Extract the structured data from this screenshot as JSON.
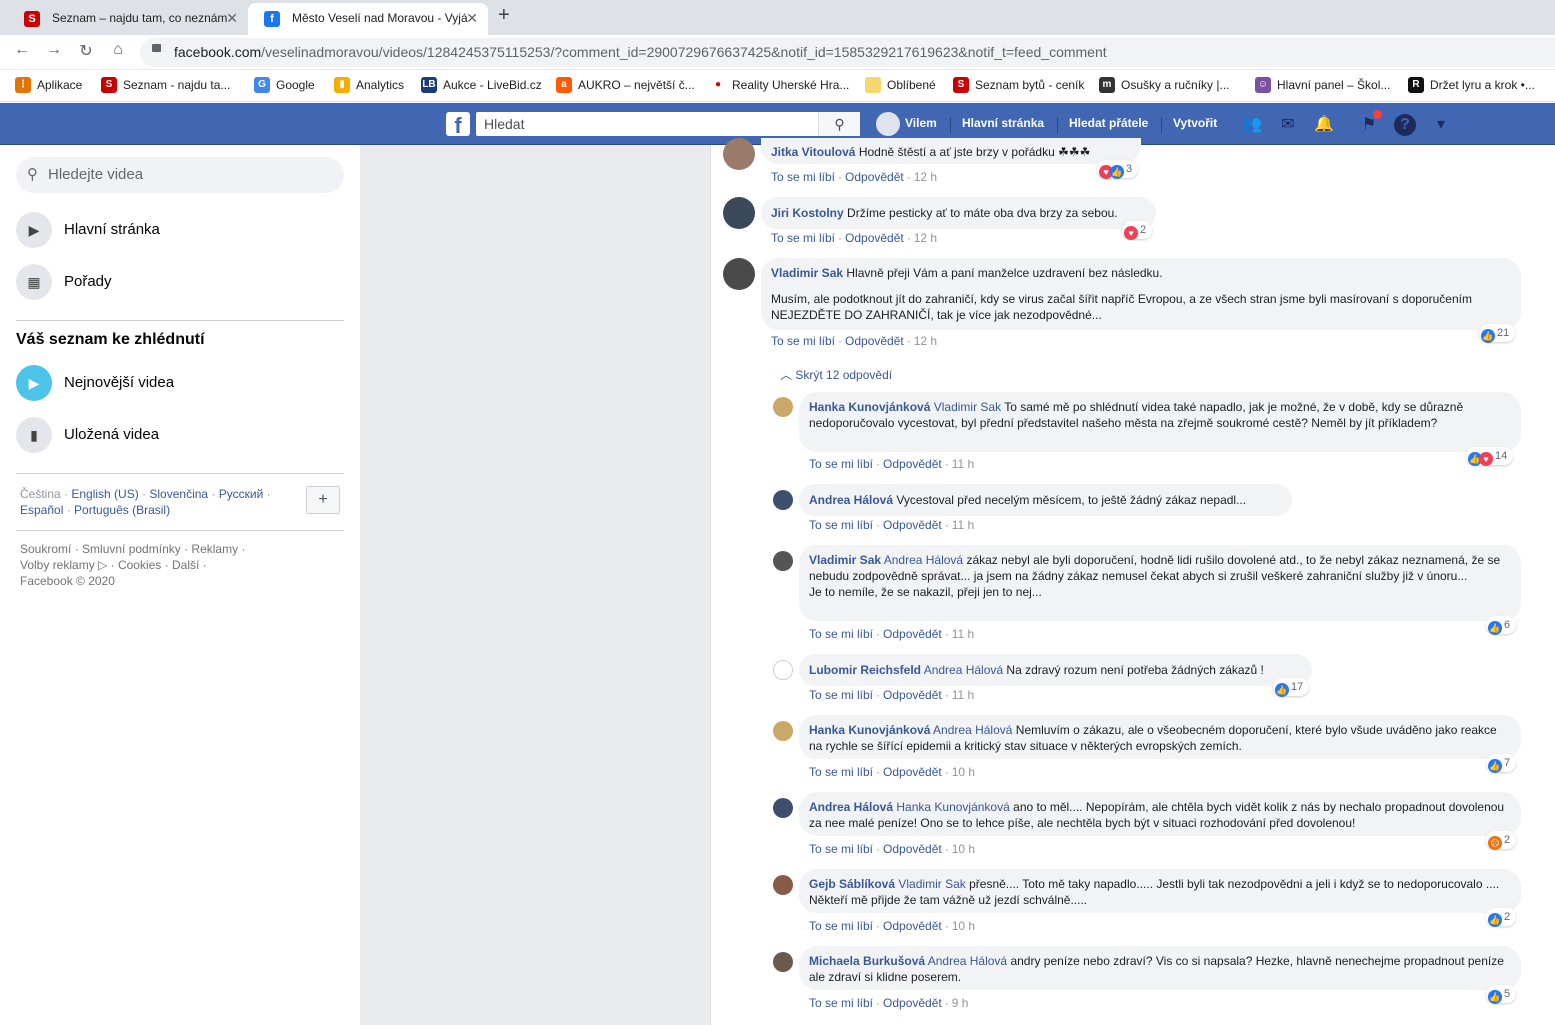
{
  "browser": {
    "tabs": [
      {
        "title": "Seznam – najdu tam, co neznám",
        "favicon": "seznam-icon",
        "color": "#cc0000"
      },
      {
        "title": "Město Veselí nad Moravou - Vyjá",
        "favicon": "facebook-icon",
        "color": "#1877f2"
      }
    ],
    "url_domain": "facebook.com",
    "url_path": "/veselinadmoravou/videos/1284245375115253/?comment_id=2900729676637425&notif_id=1585329217619623&notif_t=feed_comment",
    "bookmarks": [
      {
        "label": "Aplikace",
        "icon": "apps-grid-icon",
        "color": "#e37400"
      },
      {
        "label": "Seznam - najdu ta...",
        "icon": "seznam-icon",
        "color": "#cc0000"
      },
      {
        "label": "Google",
        "icon": "google-icon",
        "color": "#4285f4"
      },
      {
        "label": "Analytics",
        "icon": "analytics-icon",
        "color": "#f9ab00"
      },
      {
        "label": "Aukce - LiveBid.cz",
        "icon": "livebid-icon",
        "color": "#1a3a7a"
      },
      {
        "label": "AUKRO – největší č...",
        "icon": "aukro-icon",
        "color": "#ff5a00"
      },
      {
        "label": "Reality Uherské Hra...",
        "icon": "reality-icon",
        "color": "#cc0000"
      },
      {
        "label": "Oblíbené",
        "icon": "folder-icon",
        "color": "#f5d76e"
      },
      {
        "label": "Seznam bytů - ceník",
        "icon": "seznam-icon",
        "color": "#cc0000"
      },
      {
        "label": "Osušky a ručníky |...",
        "icon": "towel-shop-icon",
        "color": "#333333"
      },
      {
        "label": "Hlavní panel – Škol...",
        "icon": "school-panel-icon",
        "color": "#7b4fa3"
      },
      {
        "label": "Držet lyru a krok •...",
        "icon": "lyra-icon",
        "color": "#111111"
      }
    ]
  },
  "fbbar": {
    "search_placeholder": "Hledat",
    "user": "Vilem",
    "home": "Hlavní stránka",
    "find_friends": "Hledat přátele",
    "create": "Vytvořit"
  },
  "left": {
    "search_placeholder": "Hledejte videa",
    "nav": [
      "Hlavní stránka",
      "Pořady"
    ],
    "watchlist_heading": "Váš seznam ke zhlédnutí",
    "watchlist": [
      "Nejnovější videa",
      "Uložená videa"
    ],
    "languages": [
      "Čeština",
      "English (US)",
      "Slovenčina",
      "Русский",
      "Español",
      "Português (Brasil)"
    ],
    "footer": [
      "Soukromí",
      "Smluvní podmínky",
      "Reklamy",
      "Volby reklamy",
      "Cookies",
      "Další",
      "Facebook © 2020"
    ]
  },
  "labels": {
    "like": "To se mi líbí",
    "reply": "Odpovědět",
    "hide_replies": "Skrýt 12 odpovědí"
  },
  "comments": [
    {
      "author": "Jitka Vitoulová",
      "tag": "",
      "text": "Hodně štěstí a ať jste brzy v pořádku ☘☘☘",
      "time": "12 h",
      "reactions": "3"
    },
    {
      "author": "Jiri Kostolny",
      "tag": "",
      "text": "Držíme pesticky ať to máte oba dva brzy za sebou.",
      "time": "12 h",
      "reactions": "2"
    },
    {
      "author": "Vladimir Sak",
      "tag": "",
      "text": "Hlavně přeji Vám a paní manželce uzdravení bez následku.",
      "text2": "Musím, ale podotknout jít do zahraničí, kdy se virus začal šířit napříč Evropou, a ze všech stran jsme byli masírovaní s doporučením NEJEZDĚTE DO ZAHRANIČÍ, tak je více jak nezodpovědné...",
      "time": "12 h",
      "reactions": "21"
    }
  ],
  "replies": [
    {
      "author": "Hanka Kunovjánková",
      "tag": "Vladimir Sak",
      "text": "To samé mě po shlédnutí videa také napadlo, jak je možné, že v době, kdy se důrazně nedoporučovalo vycestovat, byl přední představitel našeho města na zřejmě soukromé cestě? Neměl by jít příkladem?",
      "time": "11 h",
      "reactions": "14"
    },
    {
      "author": "Andrea Hálová",
      "tag": "",
      "text": "Vycestoval před necelým měsícem, to ještě žádný zákaz nepadl...",
      "time": "11 h",
      "reactions": ""
    },
    {
      "author": "Vladimir Sak",
      "tag": "Andrea Hálová",
      "text": "zákaz nebyl ale byli doporučení, hodně lidi rušilo dovolené atd., to že nebyl zákaz neznamená, že se nebudu zodpovědně správat... ja jsem na žádny zákaz nemusel čekat abych si zrušil veškeré zahraniční služby již v únoru...",
      "text2": "Je to nemíle, že se nakazil, přeji jen to nej...",
      "time": "11 h",
      "reactions": "6"
    },
    {
      "author": "Lubomir Reichsfeld",
      "tag": "Andrea Hálová",
      "text": "Na zdravý rozum není potřeba žádných zákazů !",
      "time": "11 h",
      "reactions": "17"
    },
    {
      "author": "Hanka Kunovjánková",
      "tag": "Andrea Hálová",
      "text": "Nemluvím o zákazu, ale o všeobecném doporučení, které bylo všude uváděno jako reakce na rychle se šířící epidemii a kritický stav situace v některých evropských zemích.",
      "time": "10 h",
      "reactions": "7"
    },
    {
      "author": "Andrea Hálová",
      "tag": "Hanka Kunovjánková",
      "text": "ano to měl.... Nepopírám, ale chtěla bych vidět kolik z nás by nechalo propadnout dovolenou za nee malé peníze! Ono se to lehce píše, ale nechtěla bych být v situaci rozhodování před dovolenou!",
      "time": "10 h",
      "reactions": "2"
    },
    {
      "author": "Gejb Sáblíková",
      "tag": "Vladimir Sak",
      "text": "přesně.... Toto mě taky napadlo..... Jestli byli tak nezodpovědni a jeli i když se to nedoporucovalo .... Někteří mě přijde že tam vážně už jezdí schválně.....",
      "time": "10 h",
      "reactions": "2"
    },
    {
      "author": "Michaela Burkušová",
      "tag": "Andrea Hálová",
      "text": "andry peníze nebo zdraví? Vis co si napsala? Hezke, hlavně nenechejme propadnout peníze ale zdraví si klidne poserem.",
      "time": "9 h",
      "reactions": "5"
    }
  ]
}
